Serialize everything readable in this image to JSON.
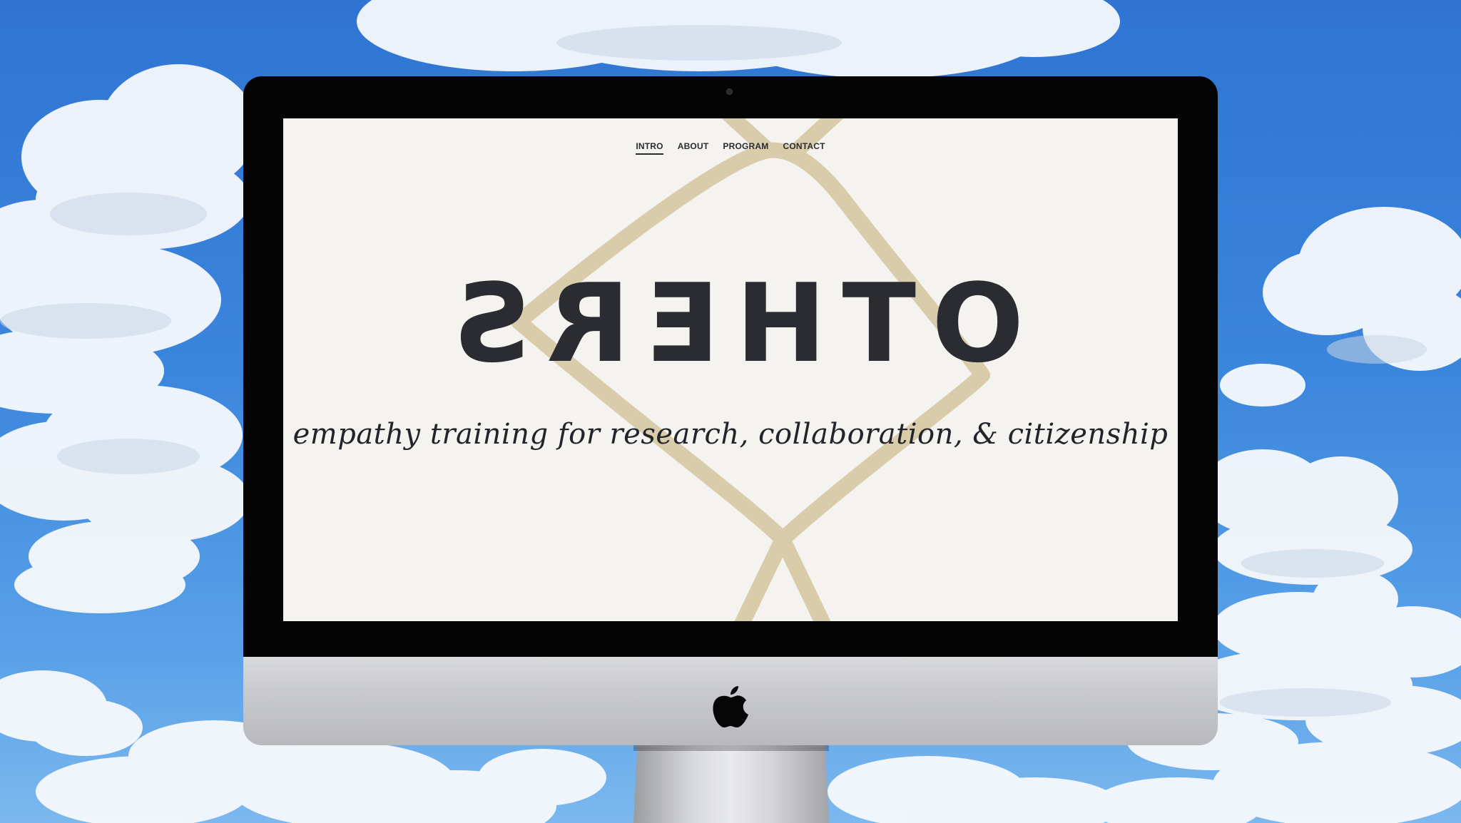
{
  "website": {
    "nav": [
      {
        "label": "INTRO",
        "active": true
      },
      {
        "label": "ABOUT",
        "active": false
      },
      {
        "label": "PROGRAM",
        "active": false
      },
      {
        "label": "CONTACT",
        "active": false
      }
    ],
    "logo_text": "OTHERS",
    "tagline": "empathy training for research, collaboration, & citizenship"
  },
  "colors": {
    "screen_background": "#f4f3ef",
    "diamond_accent": "#d9ccab",
    "text_dark": "#2b2c32",
    "sky": "#3b86dd"
  },
  "icons": {
    "monitor_logo": "apple-logo-icon",
    "camera": "webcam-icon"
  }
}
